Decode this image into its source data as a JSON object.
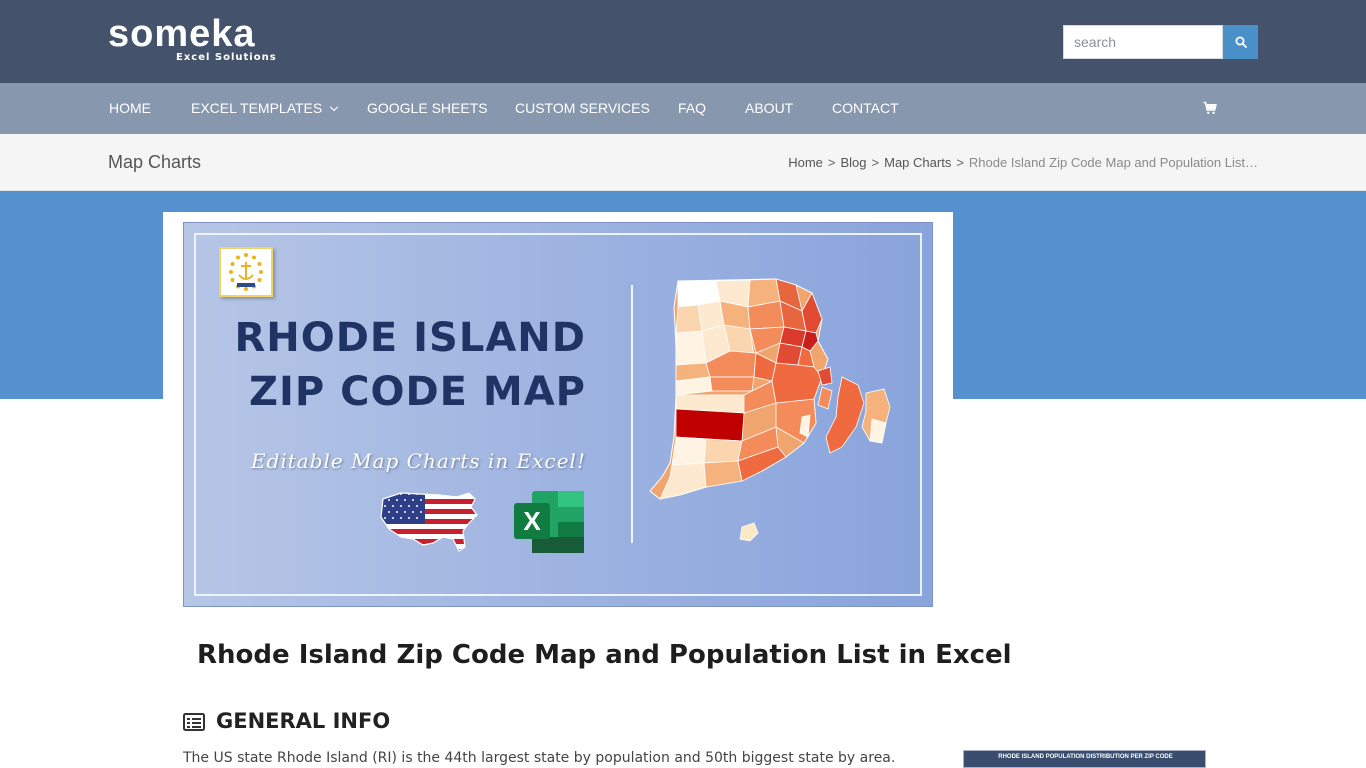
{
  "header": {
    "logo_text": "someka",
    "logo_sub": "Excel Solutions",
    "search_placeholder": "search"
  },
  "nav": {
    "items": [
      {
        "label": "HOME"
      },
      {
        "label": "EXCEL TEMPLATES"
      },
      {
        "label": "GOOGLE SHEETS"
      },
      {
        "label": "CUSTOM SERVICES"
      },
      {
        "label": "FAQ"
      },
      {
        "label": "ABOUT"
      },
      {
        "label": "CONTACT"
      }
    ]
  },
  "titlebar": {
    "title": "Map Charts",
    "breadcrumb": {
      "home": "Home",
      "blog": "Blog",
      "category": "Map Charts",
      "current": "Rhode Island Zip Code Map and Population List…",
      "sep": ">"
    }
  },
  "banner": {
    "title_line1": "RHODE ISLAND",
    "title_line2": "ZIP CODE MAP",
    "subtitle": "Editable Map Charts in Excel!",
    "excel_letter": "X"
  },
  "article": {
    "title": "Rhode Island Zip Code Map and Population List in Excel",
    "section_heading": "GENERAL INFO",
    "paragraph": "The US state Rhode Island (RI) is the 44th largest state by population and 50th biggest state by area.",
    "thumb_caption": "RHODE ISLAND POPULATION DISTRIBUTION PER ZIP CODE"
  },
  "colors": {
    "header_bg": "#44536b",
    "nav_bg": "#8797ae",
    "accent_blue": "#5590cf",
    "search_button": "#4a90c9",
    "banner_title": "#1f3464"
  },
  "icons": {
    "search": "search-icon",
    "cart": "cart-icon",
    "section": "list-icon",
    "chevron": "chevron-down-icon"
  }
}
